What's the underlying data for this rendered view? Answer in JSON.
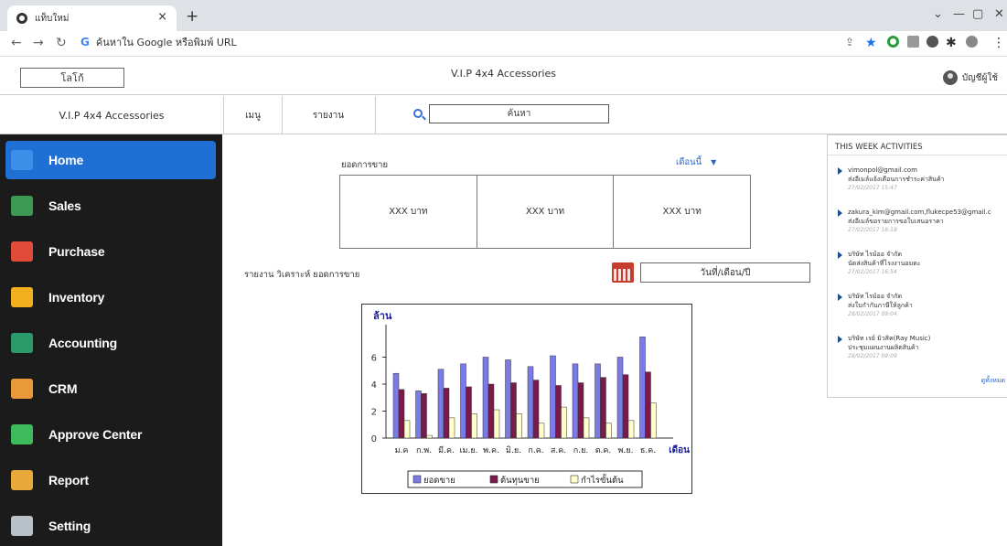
{
  "browser": {
    "tab_title": "แท็บใหม่",
    "tab_close": "×",
    "new_tab": "+",
    "address_placeholder": "ค้นหาใน Google หรือพิมพ์ URL"
  },
  "header": {
    "logo": "โลโก้",
    "app_title": "V.I.P 4x4 Accessories",
    "user_label": "บัญชีผู้ใช้"
  },
  "subnav": {
    "brand": "V.I.P 4x4 Accessories",
    "menu": "เมนู",
    "report": "รายงาน",
    "search_placeholder": "ค้นหา"
  },
  "sidebar": {
    "items": [
      {
        "label": "Home",
        "icon": "home-icon",
        "color": "#3d8ee8"
      },
      {
        "label": "Sales",
        "icon": "money-icon",
        "color": "#3d9a55"
      },
      {
        "label": "Purchase",
        "icon": "cart-icon",
        "color": "#e24b3a"
      },
      {
        "label": "Inventory",
        "icon": "box-icon",
        "color": "#f2b01e"
      },
      {
        "label": "Accounting",
        "icon": "book-icon",
        "color": "#2b9a6a"
      },
      {
        "label": "CRM",
        "icon": "people-icon",
        "color": "#e89a3a"
      },
      {
        "label": "Approve Center",
        "icon": "check-icon",
        "color": "#3dbb5a"
      },
      {
        "label": "Report",
        "icon": "report-icon",
        "color": "#e8a83a"
      },
      {
        "label": "Setting",
        "icon": "tools-icon",
        "color": "#b8c0c8"
      }
    ]
  },
  "sales": {
    "label": "ยอดการขาย",
    "period": "เดือนนี้",
    "caret": "▼",
    "kpis": [
      "XXX บาท",
      "XXX บาท",
      "XXX บาท"
    ]
  },
  "report": {
    "label": "รายงาน วิเคราะห์ ยอดการขาย",
    "date_placeholder": "วันที่/เดือน/ปี"
  },
  "chart_data": {
    "type": "bar",
    "title": "ล้าน",
    "xlabel": "เดือน",
    "ylabel": "",
    "categories": [
      "ม.ค",
      "ก.พ.",
      "มี.ค.",
      "เม.ย.",
      "พ.ค.",
      "มิ.ย.",
      "ก.ค.",
      "ส.ค.",
      "ก.ย.",
      "ต.ค.",
      "พ.ย.",
      "ธ.ค."
    ],
    "series": [
      {
        "name": "ยอดขาย",
        "color": "#7b7be8",
        "values": [
          4.8,
          3.5,
          5.1,
          5.5,
          6.0,
          5.8,
          5.3,
          6.1,
          5.5,
          5.5,
          6.0,
          7.5
        ]
      },
      {
        "name": "ต้นทุนขาย",
        "color": "#7a1a4a",
        "values": [
          3.6,
          3.3,
          3.7,
          3.8,
          4.0,
          4.1,
          4.3,
          3.9,
          4.1,
          4.5,
          4.7,
          4.9
        ]
      },
      {
        "name": "กำไรขั้นต้น",
        "color": "#ffffcc",
        "values": [
          1.3,
          0.2,
          1.5,
          1.8,
          2.1,
          1.8,
          1.1,
          2.3,
          1.5,
          1.1,
          1.3,
          2.6
        ]
      }
    ],
    "yticks": [
      0,
      2,
      4,
      6
    ],
    "ylim": [
      0,
      8
    ],
    "grid": false,
    "legend": "bottom"
  },
  "activities": {
    "title": "THIS WEEK ACTIVITIES",
    "items": [
      {
        "who": "vimonpol@gmail.com",
        "what": "ส่งอีเมล์แจ้งเตือนการชำระค่าสินค้า",
        "time": "27/02/2017 15:47"
      },
      {
        "who": "zakura_kim@gmail.com,flukecpe53@gmail.c",
        "what": "ส่งอีเมล์ขอรายการขอใบเสนอราคา",
        "time": "27/02/2017 16:18"
      },
      {
        "who": "บริษัท ไรม์ออ จำกัด",
        "what": "นัดส่งสินค้าที่โรงงานอมตะ",
        "time": "27/02/2017 16:54"
      },
      {
        "who": "บริษัท ไรม์ออ จำกัด",
        "what": "ส่งใบกำกับภาษีให้ลูกค้า",
        "time": "28/02/2017 09:04"
      },
      {
        "who": "บริษัท เรย์ มิวสิค(Ray Music)",
        "what": "ประชุมแผนงานผลิตสินค้า",
        "time": "28/02/2017 09:09"
      }
    ],
    "more": "ดูทั้งหมด"
  }
}
